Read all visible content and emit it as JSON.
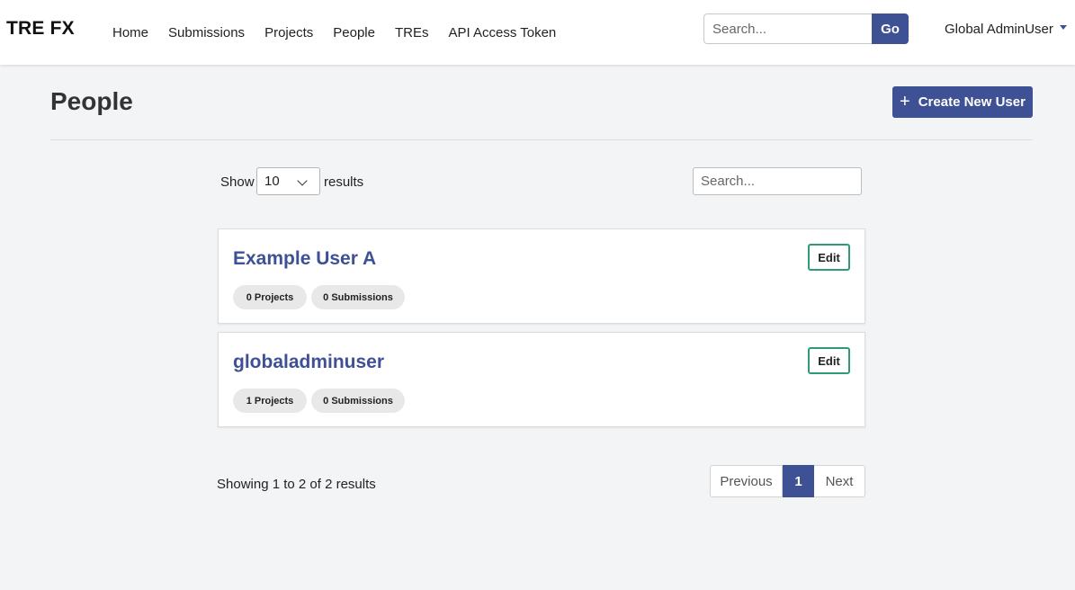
{
  "app": {
    "brand": "TRE FX"
  },
  "nav": {
    "links": [
      "Home",
      "Submissions",
      "Projects",
      "People",
      "TREs",
      "API Access Token"
    ],
    "search_placeholder": "Search...",
    "go_label": "Go",
    "user_label": "Global AdminUser"
  },
  "page": {
    "title": "People",
    "create_button": "Create New User"
  },
  "list_controls": {
    "show_label": "Show",
    "page_size": "10",
    "results_label": "results",
    "search_placeholder": "Search..."
  },
  "users": [
    {
      "name": "Example User A",
      "edit_label": "Edit",
      "projects": "0 Projects",
      "submissions": "0 Submissions"
    },
    {
      "name": "globaladminuser",
      "edit_label": "Edit",
      "projects": "1 Projects",
      "submissions": "0 Submissions"
    }
  ],
  "pagination": {
    "summary": "Showing 1 to 2 of 2 results",
    "previous": "Previous",
    "current": "1",
    "next": "Next"
  },
  "colors": {
    "primary": "#3f5195",
    "edit_border": "#2e9a7a",
    "background": "#f3f4f6"
  }
}
